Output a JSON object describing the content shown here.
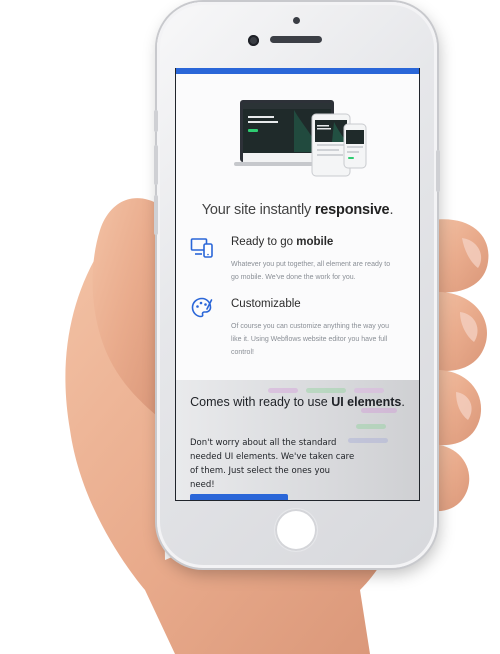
{
  "hero": {
    "tagline_prefix": "Your site instantly ",
    "tagline_bold": "responsive",
    "tagline_suffix": "."
  },
  "features": [
    {
      "icon": "responsive-devices-icon",
      "title_prefix": "Ready to go ",
      "title_bold": "mobile",
      "description": "Whatever you put together, all element are ready to go mobile. We've done the work for you."
    },
    {
      "icon": "palette-brush-icon",
      "title_prefix": "Customizable",
      "title_bold": "",
      "description": "Of course you can customize anything the way you like it. Using Webflows website editor you have full control!"
    }
  ],
  "ui_section": {
    "heading_prefix": "Comes with ready to use ",
    "heading_bold": "UI elements",
    "heading_suffix": ".",
    "body": "Don't worry about all the standard needed UI elements. We've taken care of them. Just select the ones you need!"
  },
  "colors": {
    "accent": "#2a66d8",
    "gray_section": "#dcdde0"
  }
}
